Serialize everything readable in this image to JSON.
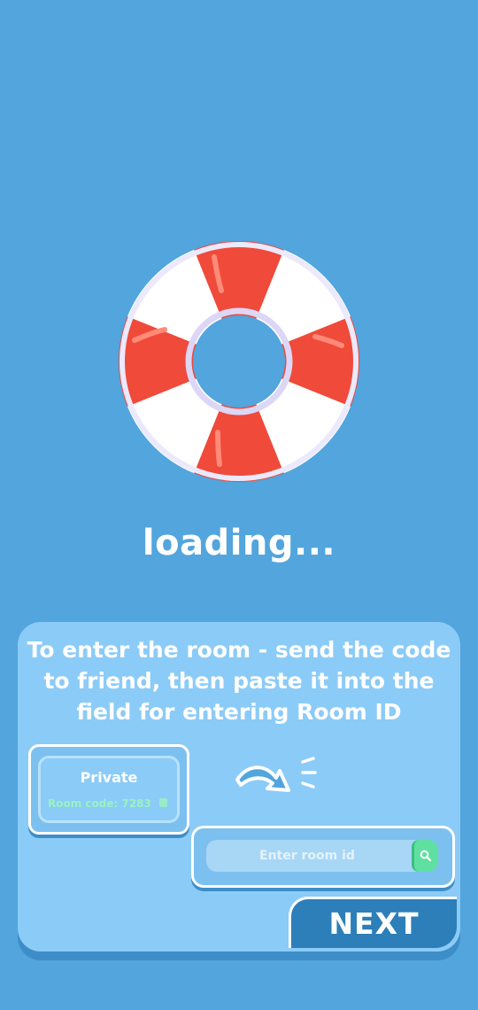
{
  "loading_text": "loading...",
  "panel": {
    "instructions": "To enter the room - send the code to friend, then paste it into the field for entering Room ID",
    "private_card": {
      "title": "Private",
      "room_code": "Room code: 7283"
    },
    "room_input": {
      "placeholder": "Enter room id",
      "value": ""
    },
    "next_label": "NEXT"
  },
  "icons": {
    "lifebuoy": "lifebuoy-icon",
    "copy": "copy-icon",
    "arrow": "curved-arrow-icon",
    "search": "search-icon"
  },
  "colors": {
    "background": "#52a5dd",
    "panel": "#8bcbf7",
    "accent_green": "#5fe0a1",
    "next_button": "#2c7fb9",
    "buoy_red": "#ef4a3a"
  }
}
